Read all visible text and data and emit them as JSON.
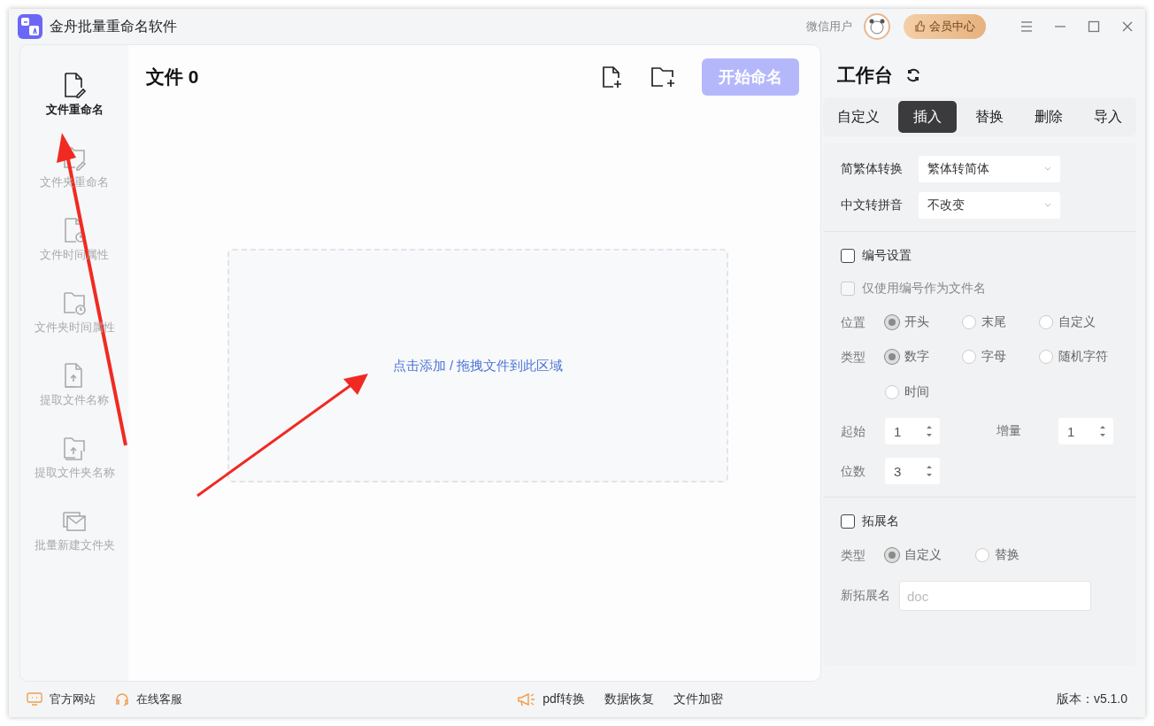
{
  "window": {
    "title": "金舟批量重命名软件"
  },
  "header": {
    "user_name": "微信用户",
    "vip_button": "会员中心"
  },
  "sidebar": {
    "items": [
      {
        "label": "文件重命名",
        "selected": true
      },
      {
        "label": "文件夹重命名",
        "selected": false
      },
      {
        "label": "文件时间属性",
        "selected": false
      },
      {
        "label": "文件夹时间属性",
        "selected": false
      },
      {
        "label": "提取文件名称",
        "selected": false
      },
      {
        "label": "提取文件夹名称",
        "selected": false
      },
      {
        "label": "批量新建文件夹",
        "selected": false
      }
    ]
  },
  "main": {
    "title": "文件 0",
    "start_button": {
      "label": "开始命名",
      "disabled": true
    },
    "drop_zone": {
      "text": "点击添加 / 拖拽文件到此区域"
    }
  },
  "workbench": {
    "title": "工作台",
    "tabs": [
      {
        "label": "自定义",
        "selected": false
      },
      {
        "label": "插入",
        "selected": true
      },
      {
        "label": "替换",
        "selected": false
      },
      {
        "label": "删除",
        "selected": false
      },
      {
        "label": "导入",
        "selected": false
      }
    ],
    "selects": [
      {
        "label": "简繁体转换",
        "value": "繁体转简体"
      },
      {
        "label": "中文转拼音",
        "value": "不改变"
      }
    ],
    "numbering": {
      "label": "编号设置",
      "checked": false,
      "only_number": {
        "label": "仅使用编号作为文件名",
        "checked": false,
        "disabled": true
      },
      "position": {
        "label": "位置",
        "options": [
          {
            "label": "开头",
            "selected": true
          },
          {
            "label": "末尾",
            "selected": false
          },
          {
            "label": "自定义",
            "selected": false
          }
        ]
      },
      "type": {
        "label": "类型",
        "options": [
          {
            "label": "数字",
            "selected": true
          },
          {
            "label": "字母",
            "selected": false
          },
          {
            "label": "随机字符",
            "selected": false
          },
          {
            "label": "时间",
            "selected": false
          }
        ]
      },
      "start": {
        "label": "起始",
        "value": "1"
      },
      "step": {
        "label": "增量",
        "value": "1"
      },
      "digits": {
        "label": "位数",
        "value": "3"
      }
    },
    "extension": {
      "label": "拓展名",
      "checked": false,
      "type": {
        "label": "类型",
        "options": [
          {
            "label": "自定义",
            "selected": true
          },
          {
            "label": "替换",
            "selected": false
          }
        ]
      },
      "new_ext": {
        "label": "新拓展名",
        "placeholder": "doc"
      }
    }
  },
  "status_bar": {
    "left": [
      "官方网站",
      "在线客服"
    ],
    "center": [
      "pdf转换",
      "数据恢复",
      "文件加密"
    ],
    "version": "版本：v5.1.0"
  }
}
